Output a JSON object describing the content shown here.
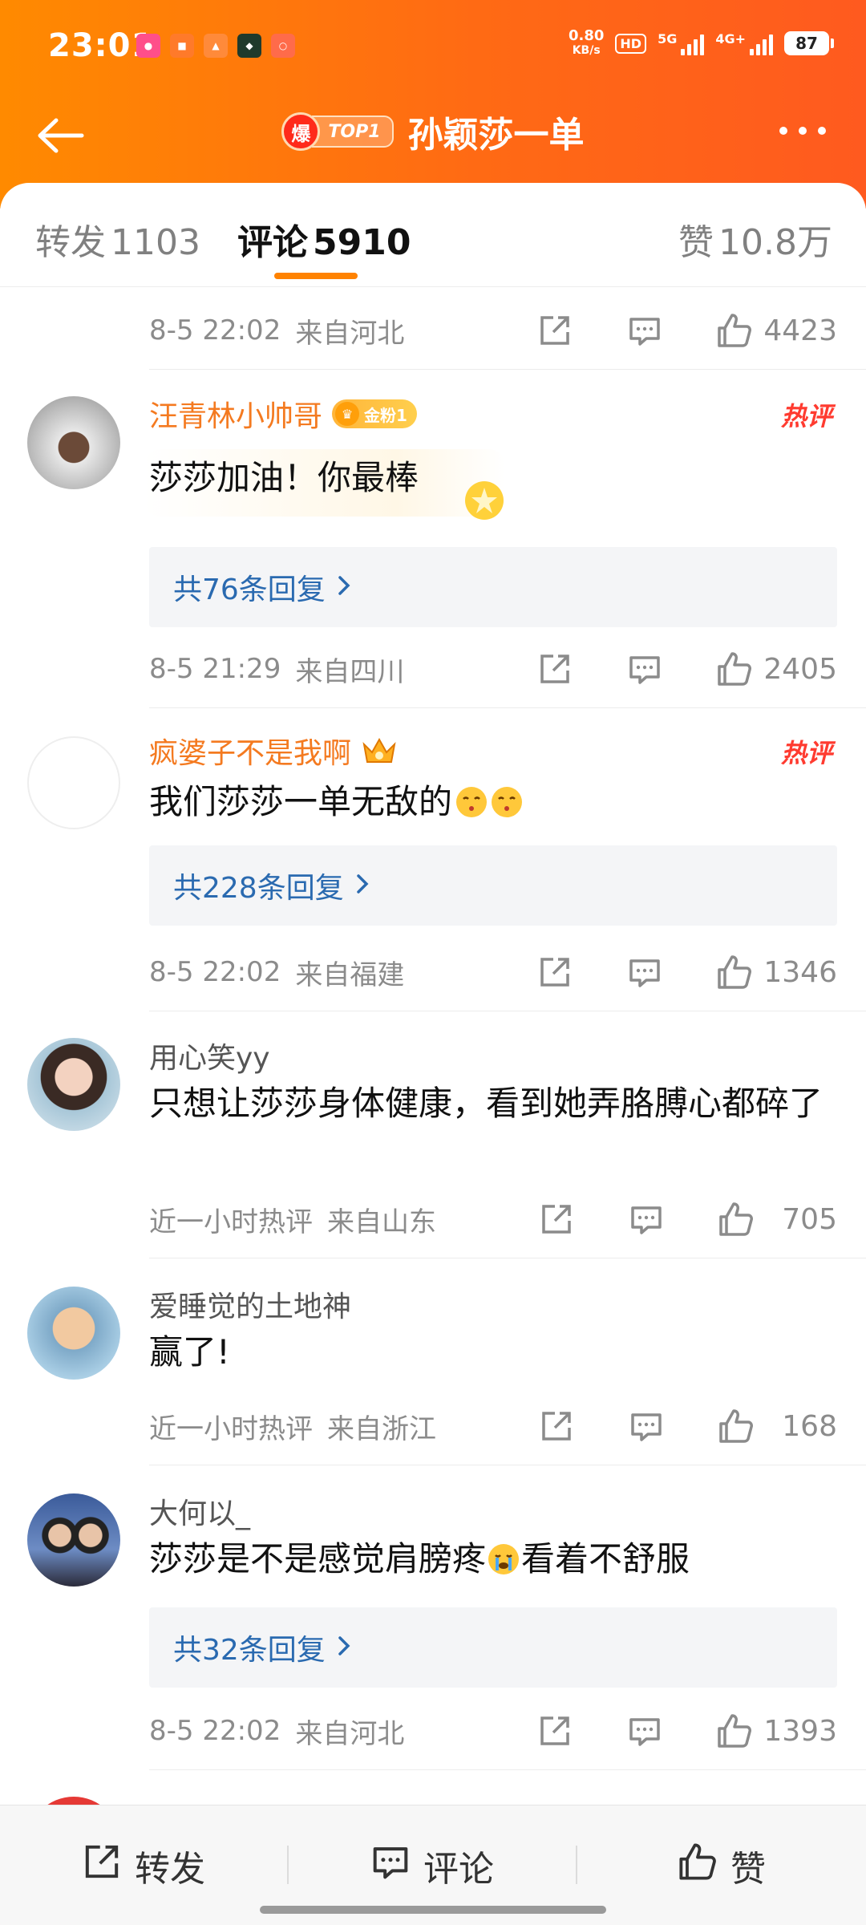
{
  "status_bar": {
    "time": "23:01",
    "net_speed_value": "0.80",
    "net_speed_unit": "KB/s",
    "hd_label": "HD",
    "sig1_label": "5G",
    "sig2_label": "4G+",
    "battery": "87"
  },
  "nav": {
    "hot_badge_char": "爆",
    "rank_label": "TOP1",
    "title": "孙颖莎一单"
  },
  "tabs": {
    "repost_label": "转发",
    "repost_count": "1103",
    "comments_label": "评论",
    "comments_count": "5910",
    "likes_label": "赞",
    "likes_count": "10.8万"
  },
  "top_meta": {
    "time": "8-5 22:02",
    "location": "来自河北",
    "likes": "4423"
  },
  "comments": [
    {
      "username": "汪青林小帅哥",
      "fan_badge": "金粉1",
      "hot_tag": "热评",
      "text": "莎莎加油！你最棒",
      "reply_label": "共76条回复",
      "time": "8-5 21:29",
      "location": "来自四川",
      "likes": "2405"
    },
    {
      "username": "疯婆子不是我啊",
      "hot_tag": "热评",
      "text": "我们莎莎一单无敌的",
      "reply_label": "共228条回复",
      "time": "8-5 22:02",
      "location": "来自福建",
      "likes": "1346"
    },
    {
      "username": "用心笑yy",
      "text": "只想让莎莎身体健康，看到她弄胳膊心都碎了",
      "time": "近一小时热评",
      "location": "来自山东",
      "likes": "705"
    },
    {
      "username": "爱睡觉的土地神",
      "text": "赢了!",
      "time": "近一小时热评",
      "location": "来自浙江",
      "likes": "168"
    },
    {
      "username": "大何以_",
      "text": "莎莎是不是感觉肩膀疼",
      "text_after_emoji": "看着不舒服",
      "reply_label": "共32条回复",
      "time": "8-5 22:02",
      "location": "来自河北",
      "likes": "1393"
    }
  ],
  "bottom_bar": {
    "repost_label": "转发",
    "comment_label": "评论",
    "like_label": "赞"
  },
  "colors": {
    "header_orange": "#ff6a14",
    "accent_orange": "#ff8200",
    "username_orange": "#f47a20",
    "hot_red": "#ff3b30",
    "reply_blue": "#2a6ab0"
  }
}
